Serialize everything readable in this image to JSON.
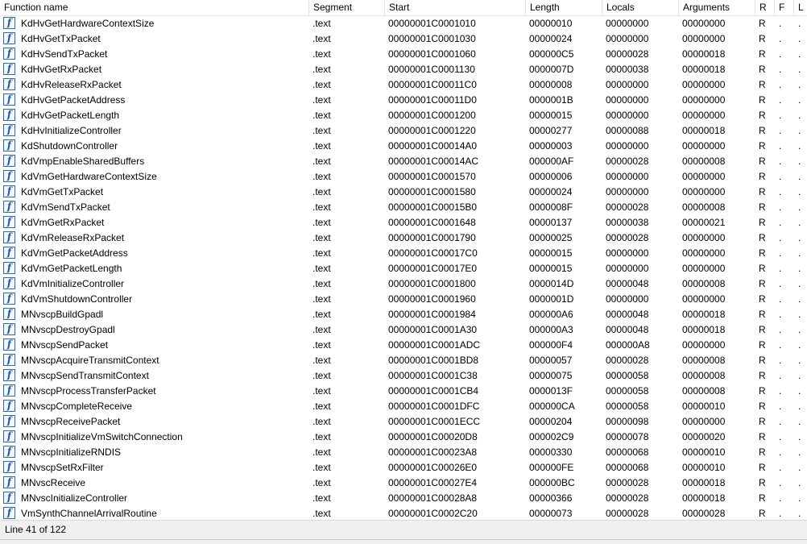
{
  "columns": [
    {
      "key": "name",
      "label": "Function name"
    },
    {
      "key": "segment",
      "label": "Segment"
    },
    {
      "key": "start",
      "label": "Start"
    },
    {
      "key": "length",
      "label": "Length"
    },
    {
      "key": "locals",
      "label": "Locals"
    },
    {
      "key": "arguments",
      "label": "Arguments"
    },
    {
      "key": "r",
      "label": "R"
    },
    {
      "key": "f",
      "label": "F"
    },
    {
      "key": "l",
      "label": "L"
    }
  ],
  "icon": {
    "name": "function-icon",
    "glyph": "f",
    "border": "#2a6db3",
    "color": "#1c5aa6"
  },
  "rows": [
    {
      "name": "KdHvGetHardwareContextSize",
      "segment": ".text",
      "start": "00000001C0001010",
      "length": "00000010",
      "locals": "00000000",
      "arguments": "00000000",
      "r": "R",
      "f": ".",
      "l": "."
    },
    {
      "name": "KdHvGetTxPacket",
      "segment": ".text",
      "start": "00000001C0001030",
      "length": "00000024",
      "locals": "00000000",
      "arguments": "00000000",
      "r": "R",
      "f": ".",
      "l": "."
    },
    {
      "name": "KdHvSendTxPacket",
      "segment": ".text",
      "start": "00000001C0001060",
      "length": "000000C5",
      "locals": "00000028",
      "arguments": "00000018",
      "r": "R",
      "f": ".",
      "l": "."
    },
    {
      "name": "KdHvGetRxPacket",
      "segment": ".text",
      "start": "00000001C0001130",
      "length": "0000007D",
      "locals": "00000038",
      "arguments": "00000018",
      "r": "R",
      "f": ".",
      "l": "."
    },
    {
      "name": "KdHvReleaseRxPacket",
      "segment": ".text",
      "start": "00000001C00011C0",
      "length": "00000008",
      "locals": "00000000",
      "arguments": "00000000",
      "r": "R",
      "f": ".",
      "l": "."
    },
    {
      "name": "KdHvGetPacketAddress",
      "segment": ".text",
      "start": "00000001C00011D0",
      "length": "0000001B",
      "locals": "00000000",
      "arguments": "00000000",
      "r": "R",
      "f": ".",
      "l": "."
    },
    {
      "name": "KdHvGetPacketLength",
      "segment": ".text",
      "start": "00000001C0001200",
      "length": "00000015",
      "locals": "00000000",
      "arguments": "00000000",
      "r": "R",
      "f": ".",
      "l": "."
    },
    {
      "name": "KdHvInitializeController",
      "segment": ".text",
      "start": "00000001C0001220",
      "length": "00000277",
      "locals": "00000088",
      "arguments": "00000018",
      "r": "R",
      "f": ".",
      "l": "."
    },
    {
      "name": "KdShutdownController",
      "segment": ".text",
      "start": "00000001C00014A0",
      "length": "00000003",
      "locals": "00000000",
      "arguments": "00000000",
      "r": "R",
      "f": ".",
      "l": "."
    },
    {
      "name": "KdVmpEnableSharedBuffers",
      "segment": ".text",
      "start": "00000001C00014AC",
      "length": "000000AF",
      "locals": "00000028",
      "arguments": "00000008",
      "r": "R",
      "f": ".",
      "l": "."
    },
    {
      "name": "KdVmGetHardwareContextSize",
      "segment": ".text",
      "start": "00000001C0001570",
      "length": "00000006",
      "locals": "00000000",
      "arguments": "00000000",
      "r": "R",
      "f": ".",
      "l": "."
    },
    {
      "name": "KdVmGetTxPacket",
      "segment": ".text",
      "start": "00000001C0001580",
      "length": "00000024",
      "locals": "00000000",
      "arguments": "00000000",
      "r": "R",
      "f": ".",
      "l": "."
    },
    {
      "name": "KdVmSendTxPacket",
      "segment": ".text",
      "start": "00000001C00015B0",
      "length": "0000008F",
      "locals": "00000028",
      "arguments": "00000008",
      "r": "R",
      "f": ".",
      "l": "."
    },
    {
      "name": "KdVmGetRxPacket",
      "segment": ".text",
      "start": "00000001C0001648",
      "length": "00000137",
      "locals": "00000038",
      "arguments": "00000021",
      "r": "R",
      "f": ".",
      "l": "."
    },
    {
      "name": "KdVmReleaseRxPacket",
      "segment": ".text",
      "start": "00000001C0001790",
      "length": "00000025",
      "locals": "00000028",
      "arguments": "00000000",
      "r": "R",
      "f": ".",
      "l": "."
    },
    {
      "name": "KdVmGetPacketAddress",
      "segment": ".text",
      "start": "00000001C00017C0",
      "length": "00000015",
      "locals": "00000000",
      "arguments": "00000000",
      "r": "R",
      "f": ".",
      "l": "."
    },
    {
      "name": "KdVmGetPacketLength",
      "segment": ".text",
      "start": "00000001C00017E0",
      "length": "00000015",
      "locals": "00000000",
      "arguments": "00000000",
      "r": "R",
      "f": ".",
      "l": "."
    },
    {
      "name": "KdVmInitializeController",
      "segment": ".text",
      "start": "00000001C0001800",
      "length": "0000014D",
      "locals": "00000048",
      "arguments": "00000008",
      "r": "R",
      "f": ".",
      "l": "."
    },
    {
      "name": "KdVmShutdownController",
      "segment": ".text",
      "start": "00000001C0001960",
      "length": "0000001D",
      "locals": "00000000",
      "arguments": "00000000",
      "r": "R",
      "f": ".",
      "l": "."
    },
    {
      "name": "MNvscpBuildGpadl",
      "segment": ".text",
      "start": "00000001C0001984",
      "length": "000000A6",
      "locals": "00000048",
      "arguments": "00000018",
      "r": "R",
      "f": ".",
      "l": "."
    },
    {
      "name": "MNvscpDestroyGpadl",
      "segment": ".text",
      "start": "00000001C0001A30",
      "length": "000000A3",
      "locals": "00000048",
      "arguments": "00000018",
      "r": "R",
      "f": ".",
      "l": "."
    },
    {
      "name": "MNvscpSendPacket",
      "segment": ".text",
      "start": "00000001C0001ADC",
      "length": "000000F4",
      "locals": "000000A8",
      "arguments": "00000000",
      "r": "R",
      "f": ".",
      "l": "."
    },
    {
      "name": "MNvscpAcquireTransmitContext",
      "segment": ".text",
      "start": "00000001C0001BD8",
      "length": "00000057",
      "locals": "00000028",
      "arguments": "00000008",
      "r": "R",
      "f": ".",
      "l": "."
    },
    {
      "name": "MNvscpSendTransmitContext",
      "segment": ".text",
      "start": "00000001C0001C38",
      "length": "00000075",
      "locals": "00000058",
      "arguments": "00000008",
      "r": "R",
      "f": ".",
      "l": "."
    },
    {
      "name": "MNvscpProcessTransferPacket",
      "segment": ".text",
      "start": "00000001C0001CB4",
      "length": "0000013F",
      "locals": "00000058",
      "arguments": "00000008",
      "r": "R",
      "f": ".",
      "l": "."
    },
    {
      "name": "MNvscpCompleteReceive",
      "segment": ".text",
      "start": "00000001C0001DFC",
      "length": "000000CA",
      "locals": "00000058",
      "arguments": "00000010",
      "r": "R",
      "f": ".",
      "l": "."
    },
    {
      "name": "MNvscpReceivePacket",
      "segment": ".text",
      "start": "00000001C0001ECC",
      "length": "00000204",
      "locals": "00000098",
      "arguments": "00000000",
      "r": "R",
      "f": ".",
      "l": "."
    },
    {
      "name": "MNvscpInitializeVmSwitchConnection",
      "segment": ".text",
      "start": "00000001C00020D8",
      "length": "000002C9",
      "locals": "00000078",
      "arguments": "00000020",
      "r": "R",
      "f": ".",
      "l": "."
    },
    {
      "name": "MNvscpInitializeRNDIS",
      "segment": ".text",
      "start": "00000001C00023A8",
      "length": "00000330",
      "locals": "00000068",
      "arguments": "00000010",
      "r": "R",
      "f": ".",
      "l": "."
    },
    {
      "name": "MNvscpSetRxFilter",
      "segment": ".text",
      "start": "00000001C00026E0",
      "length": "000000FE",
      "locals": "00000068",
      "arguments": "00000010",
      "r": "R",
      "f": ".",
      "l": "."
    },
    {
      "name": "MNvscReceive",
      "segment": ".text",
      "start": "00000001C00027E4",
      "length": "000000BC",
      "locals": "00000028",
      "arguments": "00000018",
      "r": "R",
      "f": ".",
      "l": "."
    },
    {
      "name": "MNvscInitializeController",
      "segment": ".text",
      "start": "00000001C00028A8",
      "length": "00000366",
      "locals": "00000028",
      "arguments": "00000018",
      "r": "R",
      "f": ".",
      "l": "."
    },
    {
      "name": "VmSynthChannelArrivalRoutine",
      "segment": ".text",
      "start": "00000001C0002C20",
      "length": "00000073",
      "locals": "00000028",
      "arguments": "00000028",
      "r": "R",
      "f": ".",
      "l": "."
    }
  ],
  "status": {
    "text": "Line 41 of 122"
  }
}
